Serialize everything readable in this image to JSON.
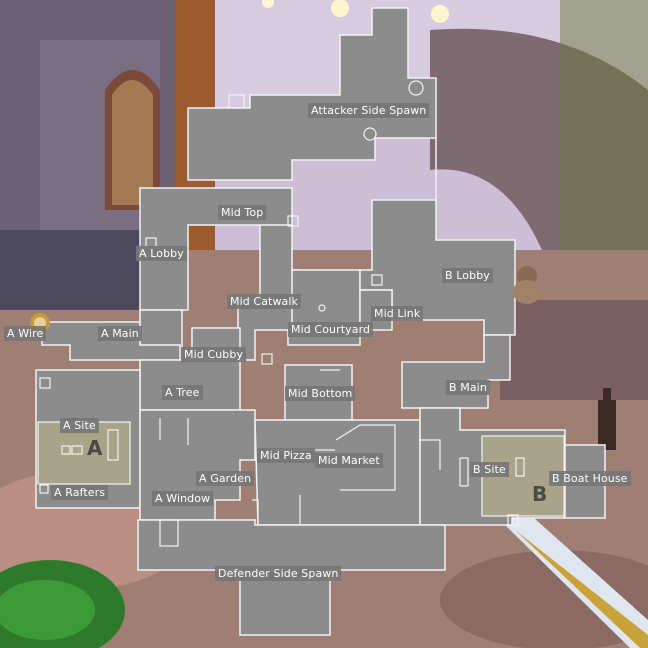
{
  "map": {
    "labels": {
      "attacker_spawn": "Attacker Side Spawn",
      "mid_top": "Mid Top",
      "a_lobby": "A Lobby",
      "b_lobby": "B Lobby",
      "mid_catwalk": "Mid Catwalk",
      "mid_link": "Mid Link",
      "mid_courtyard": "Mid Courtyard",
      "a_wire": "A Wire",
      "a_main": "A Main",
      "mid_cubby": "Mid Cubby",
      "a_tree": "A Tree",
      "mid_bottom": "Mid Bottom",
      "b_main": "B Main",
      "a_site": "A Site",
      "mid_pizza": "Mid Pizza",
      "mid_market": "Mid Market",
      "b_site": "B Site",
      "a_garden": "A Garden",
      "b_boat_house": "B Boat House",
      "a_rafters": "A Rafters",
      "a_window": "A Window",
      "defender_spawn": "Defender Side Spawn"
    },
    "site_letters": {
      "a": "A",
      "b": "B"
    },
    "colors": {
      "floor": "#8c8c8c",
      "site_zone": "#a8a48a",
      "wall": "#f2f2f2",
      "label_bg": "#767676"
    }
  }
}
